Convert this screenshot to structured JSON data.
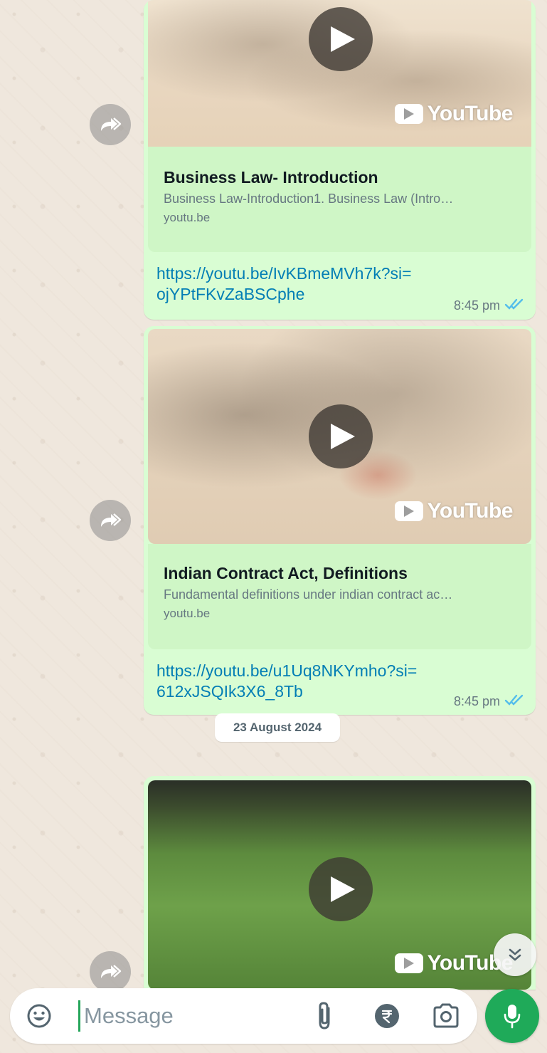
{
  "messages": [
    {
      "preview_title": "Business Law- Introduction",
      "preview_desc": "Business Law-Introduction1. Business Law (Intro…",
      "preview_domain": "youtu.be",
      "link_line1": "https://youtu.be/IvKBmeMVh7k?si=",
      "link_line2": "ojYPtFKvZaBSCphe",
      "time": "8:45 pm",
      "youtube_label": "YouTube"
    },
    {
      "preview_title": "Indian Contract Act, Definitions",
      "preview_desc": "Fundamental definitions under indian contract ac…",
      "preview_domain": "youtu.be",
      "link_line1": "https://youtu.be/u1Uq8NKYmho?si=",
      "link_line2": "612xJSQIk3X6_8Tb",
      "time": "8:45 pm",
      "youtube_label": "YouTube"
    },
    {
      "youtube_label": "YouTube"
    }
  ],
  "date_separator": "23 August 2024",
  "composer": {
    "placeholder": "Message"
  },
  "icons": {
    "emoji": "emoji-icon",
    "attach": "paperclip-icon",
    "payment": "rupee-icon",
    "camera": "camera-icon",
    "mic": "microphone-icon",
    "forward": "forward-icon",
    "scroll_down": "double-chevron-down-icon",
    "read_receipt": "double-check-icon"
  },
  "colors": {
    "bubble": "#d9fdd3",
    "link": "#027eb5",
    "accent": "#1faa59",
    "read_tick": "#53bdeb"
  }
}
